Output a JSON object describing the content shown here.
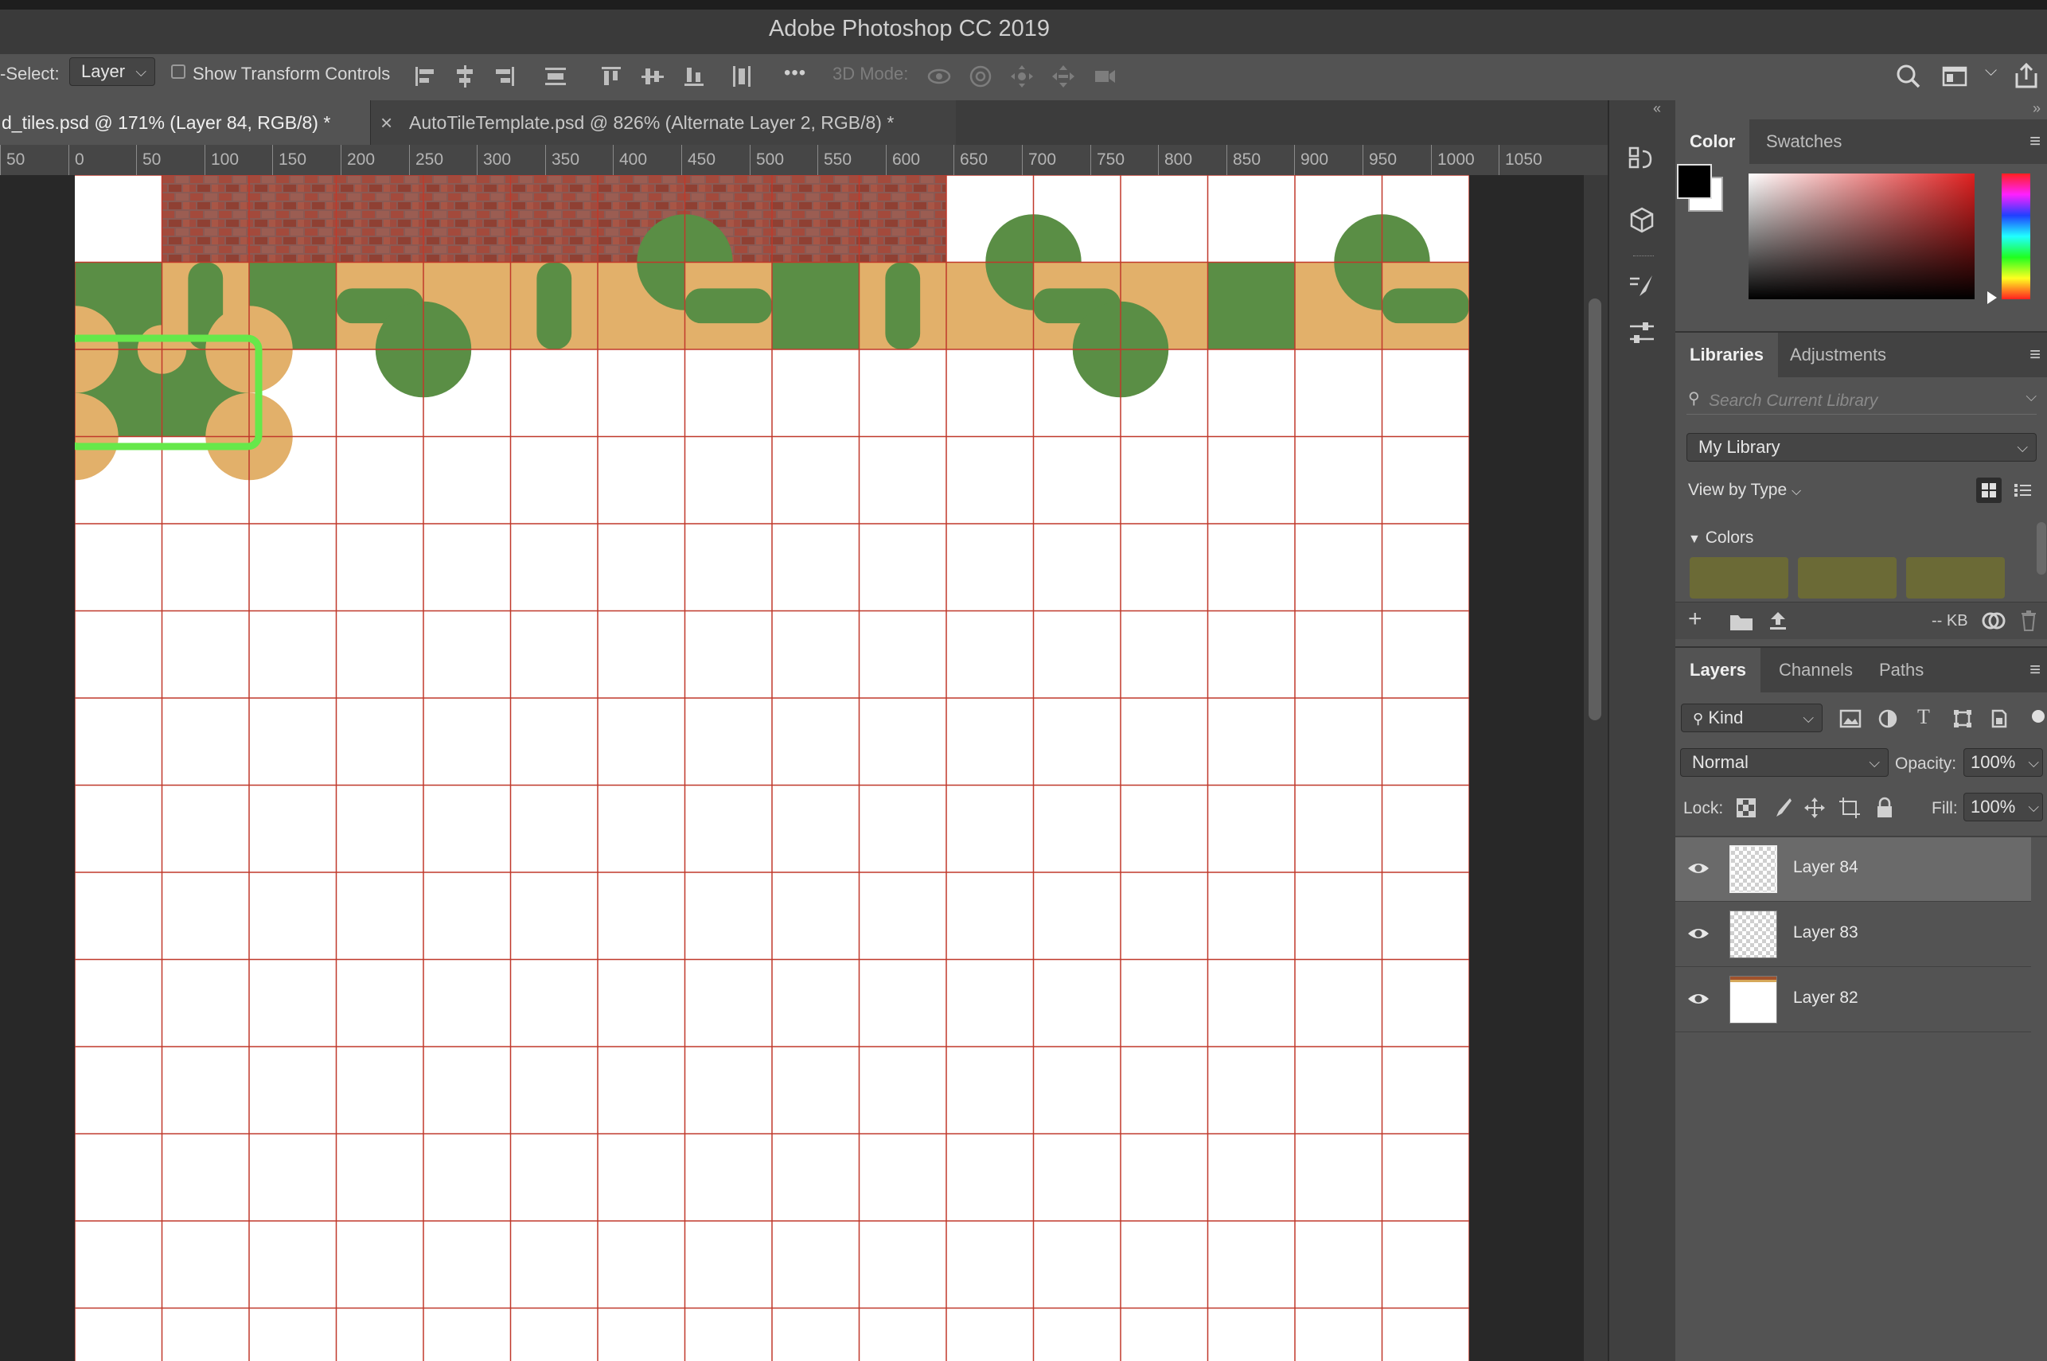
{
  "app": {
    "title": "Adobe Photoshop CC 2019"
  },
  "options_bar": {
    "auto_select_label": "-Select:",
    "auto_select_value": "Layer",
    "show_transform_label": "Show Transform Controls",
    "more_glyph": "•••",
    "mode_3d_label": "3D Mode:"
  },
  "tabs": [
    {
      "label": "d_tiles.psd @ 171% (Layer 84, RGB/8) *",
      "active": true
    },
    {
      "label": "AutoTileTemplate.psd @ 826% (Alternate Layer 2, RGB/8) *",
      "active": false,
      "close": "×"
    }
  ],
  "ruler": {
    "labels": [
      "50",
      "0",
      "50",
      "100",
      "150",
      "200",
      "250",
      "300",
      "350",
      "400",
      "450",
      "500",
      "550",
      "600",
      "650",
      "700",
      "750",
      "800",
      "850",
      "900",
      "950",
      "1000",
      "1050"
    ]
  },
  "canvas": {
    "grid_color": "#c0392b",
    "selection_color": "#66e84a",
    "brick_tiles": 9,
    "terrain_tiles": 16
  },
  "color_panel": {
    "tabs": [
      "Color",
      "Swatches"
    ],
    "foreground": "#000000",
    "background": "#ffffff"
  },
  "libraries_panel": {
    "tabs": [
      "Libraries",
      "Adjustments"
    ],
    "search_placeholder": "Search Current Library",
    "library_name": "My Library",
    "view_by": "View by Type",
    "section": "Colors",
    "swatch_color": "#6b6a36",
    "size_label": "-- KB"
  },
  "layers_panel": {
    "tabs": [
      "Layers",
      "Channels",
      "Paths"
    ],
    "filter_kind": "Kind",
    "blend_mode": "Normal",
    "opacity_label": "Opacity:",
    "opacity_value": "100%",
    "lock_label": "Lock:",
    "fill_label": "Fill:",
    "fill_value": "100%",
    "layers": [
      {
        "name": "Layer 84",
        "selected": true
      },
      {
        "name": "Layer 83",
        "selected": false
      },
      {
        "name": "Layer 82",
        "selected": false
      }
    ]
  }
}
